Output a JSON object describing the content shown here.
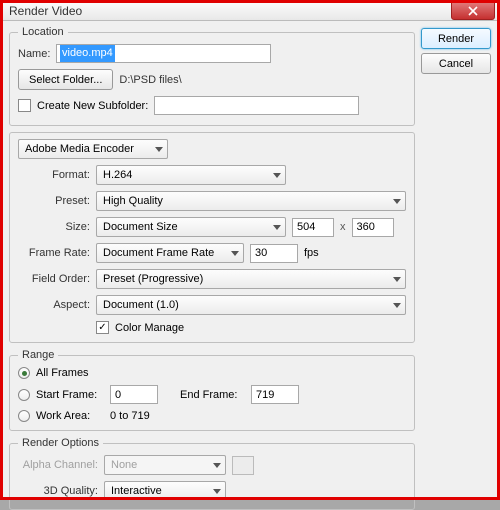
{
  "window": {
    "title": "Render Video"
  },
  "buttons": {
    "render": "Render",
    "cancel": "Cancel",
    "close_icon": "X"
  },
  "location": {
    "legend": "Location",
    "name_label": "Name:",
    "name_value": "video.mp4",
    "select_folder_btn": "Select Folder...",
    "path": "D:\\PSD files\\",
    "create_subfolder_label": "Create New Subfolder:",
    "subfolder_value": ""
  },
  "encoder": {
    "engine": "Adobe Media Encoder",
    "format_label": "Format:",
    "format_value": "H.264",
    "preset_label": "Preset:",
    "preset_value": "High Quality",
    "size_label": "Size:",
    "size_mode": "Document Size",
    "width": "504",
    "height": "360",
    "x": "x",
    "framerate_label": "Frame Rate:",
    "framerate_mode": "Document Frame Rate",
    "framerate_value": "30",
    "fps": "fps",
    "fieldorder_label": "Field Order:",
    "fieldorder_value": "Preset (Progressive)",
    "aspect_label": "Aspect:",
    "aspect_value": "Document (1.0)",
    "color_manage_label": "Color Manage"
  },
  "range": {
    "legend": "Range",
    "all_frames": "All Frames",
    "start_frame_label": "Start Frame:",
    "start_frame": "0",
    "end_frame_label": "End Frame:",
    "end_frame": "719",
    "work_area_label": "Work Area:",
    "work_area_value": "0 to 719"
  },
  "render_options": {
    "legend": "Render Options",
    "alpha_label": "Alpha Channel:",
    "alpha_value": "None",
    "quality_label": "3D Quality:",
    "quality_value": "Interactive"
  }
}
